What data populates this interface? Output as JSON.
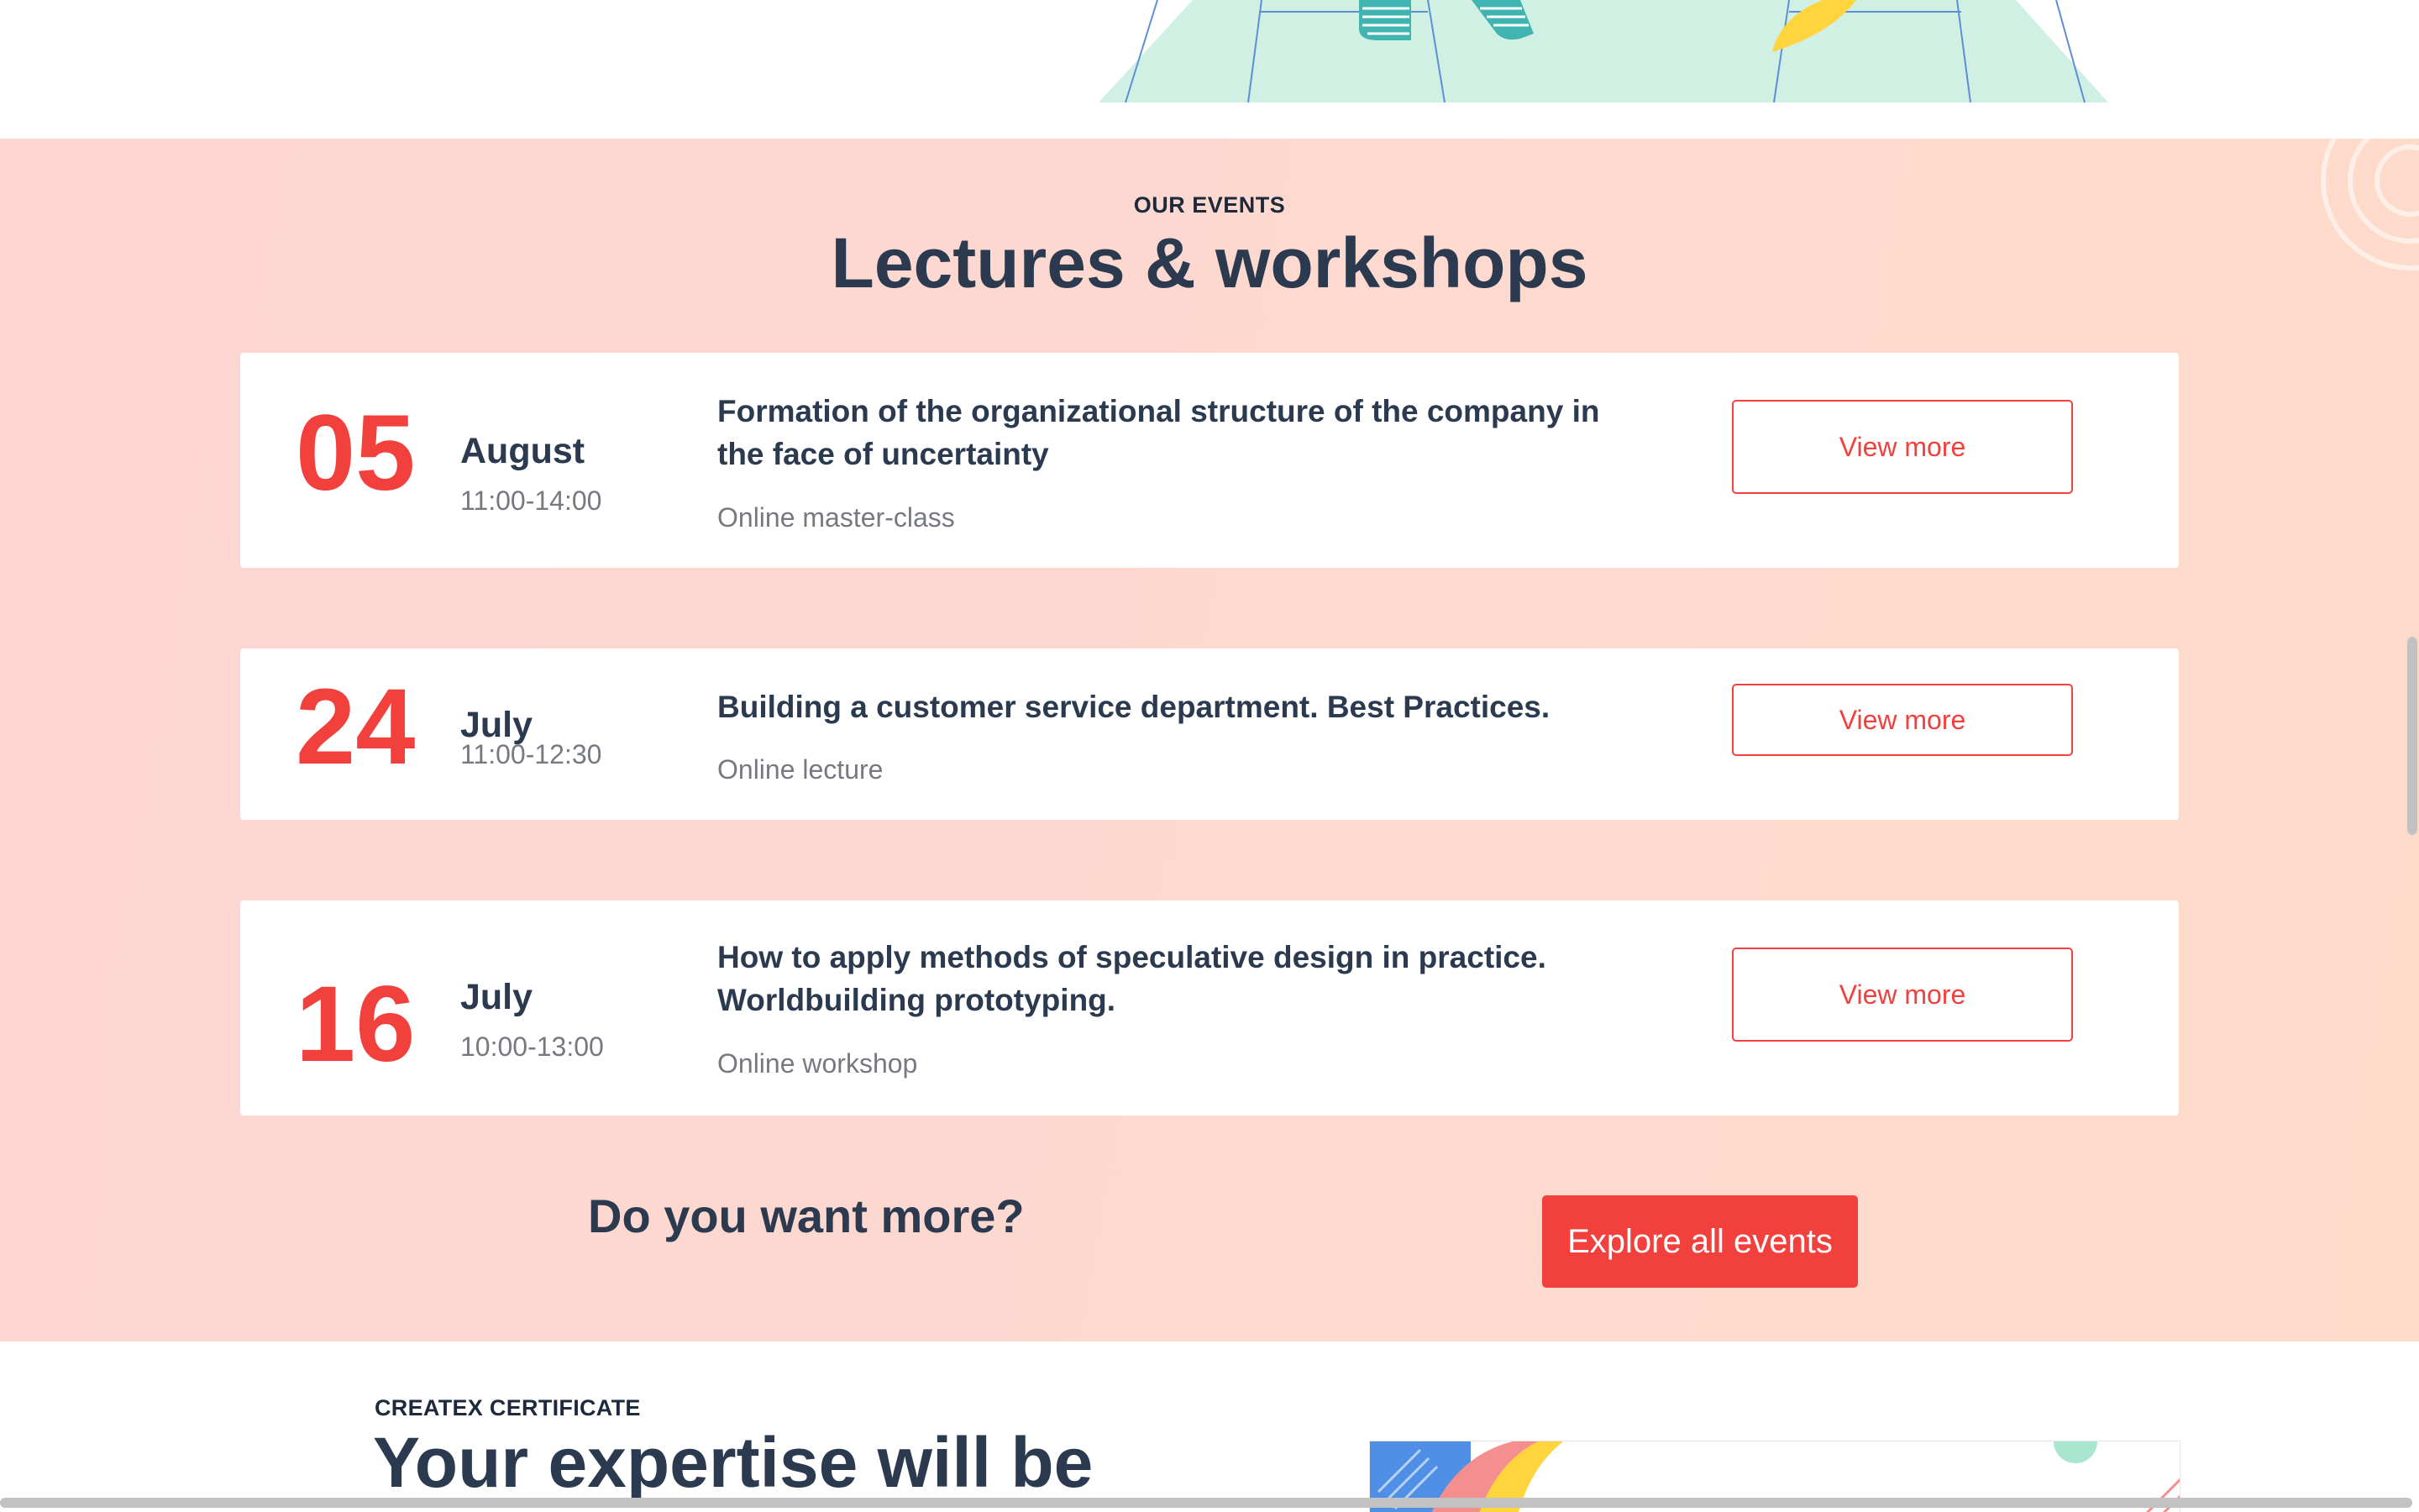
{
  "events_section": {
    "overline": "OUR EVENTS",
    "title": "Lectures & workshops",
    "events": [
      {
        "day": "05",
        "month": "August",
        "time": "11:00-14:00",
        "title": "Formation of the organizational structure of the company in the face of uncertainty",
        "type": "Online master-class",
        "button_label": "View more"
      },
      {
        "day": "24",
        "month": "July",
        "time": "11:00-12:30",
        "title": "Building a customer service department. Best Practices.",
        "type": "Online lecture",
        "button_label": "View more"
      },
      {
        "day": "16",
        "month": "July",
        "time": "10:00-13:00",
        "title": "How to apply methods of speculative design in practice. Worldbuilding prototyping.",
        "type": "Online workshop",
        "button_label": "View more"
      }
    ],
    "more_question": "Do you want more?",
    "explore_label": "Explore all events"
  },
  "certificate_section": {
    "overline": "CREATEX CERTIFICATE",
    "title": "Your expertise will be"
  },
  "colors": {
    "accent": "#f2403d",
    "heading": "#2b3a4f",
    "muted": "#76797f",
    "section_bg": "#fdd8d0",
    "illustration_mint": "#d0f0e4",
    "illustration_yellow": "#ffd43d",
    "illustration_teal": "#3fb4b1"
  }
}
